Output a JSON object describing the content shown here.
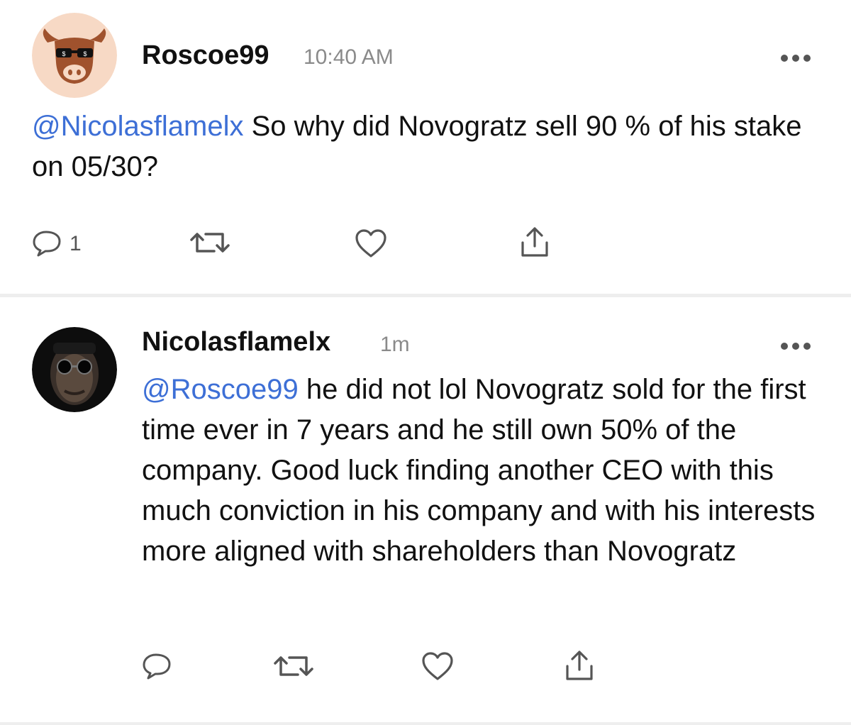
{
  "colors": {
    "mention": "#3d6fd6",
    "icon": "#555555",
    "divider": "#eeeeee",
    "avatar_bg": "#f7d9c5",
    "bull_brown": "#a0522d"
  },
  "posts": [
    {
      "username": "Roscoe99",
      "timestamp": "10:40 AM",
      "avatar_icon": "bull-with-sunglasses-avatar",
      "mention": "@Nicolasflamelx",
      "text": " So why did Novogratz sell 90 % of his stake on 05/30?",
      "actions": {
        "reply_count": "1",
        "icons": [
          "reply-icon",
          "repost-icon",
          "like-icon",
          "share-icon"
        ]
      }
    },
    {
      "username": "Nicolasflamelx",
      "timestamp": "1m",
      "avatar_icon": "man-with-sunglasses-avatar",
      "mention": "@Roscoe99",
      "text": " he did not lol Novogratz sold for the first time ever in 7 years and he still own 50% of the company. Good luck finding another CEO with this much conviction in his company and with his interests more aligned with shareholders than Novogratz",
      "actions": {
        "reply_count": "",
        "icons": [
          "reply-icon",
          "repost-icon",
          "like-icon",
          "share-icon"
        ]
      }
    }
  ]
}
